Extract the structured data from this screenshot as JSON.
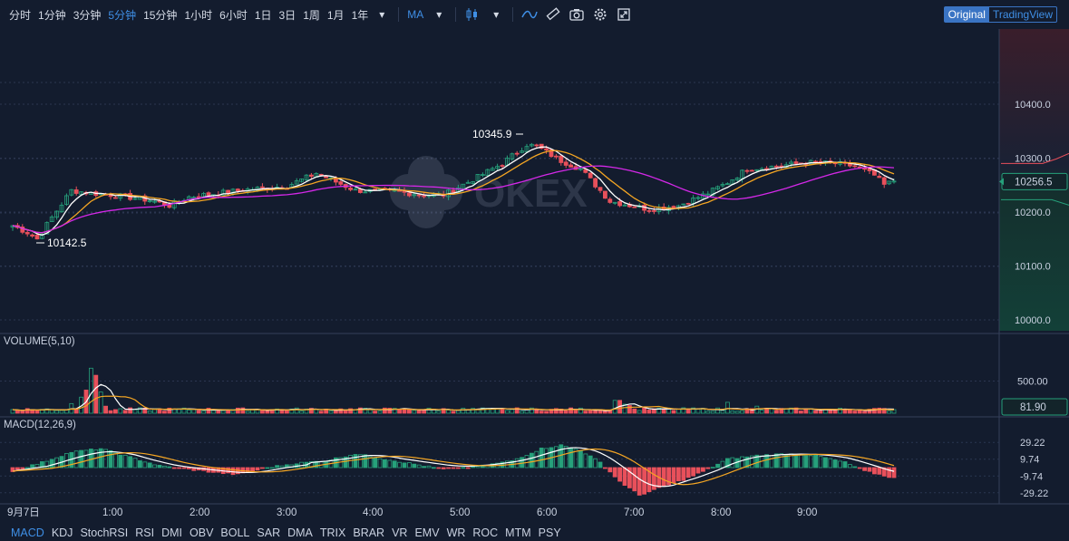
{
  "toolbar": {
    "intervals": [
      "分时",
      "1分钟",
      "3分钟",
      "5分钟",
      "15分钟",
      "1小时",
      "6小时",
      "1日",
      "3日",
      "1周",
      "1月",
      "1年"
    ],
    "active_interval": "5分钟",
    "indicator_label": "MA"
  },
  "view_toggle": {
    "original": "Original",
    "tradingview": "TradingView"
  },
  "watermark": "OKEX",
  "colors": {
    "up": "#26a17b",
    "down": "#e8505b",
    "ma5": "#ffffff",
    "ma10": "#f5a623",
    "ma30": "#d428e8",
    "grid": "#2b3650",
    "background": "#131c2e"
  },
  "chart_data": {
    "type": "candlestick",
    "price_axis": {
      "ticks": [
        10000,
        10100,
        10200,
        10300,
        10400
      ],
      "tick_labels": [
        "10000.0",
        "10100.0",
        "10200.0",
        "10300.0",
        "10400.0"
      ],
      "current_price": "10256.5"
    },
    "annotations": {
      "high_label": "10345.9",
      "low_label": "10142.5"
    },
    "time_axis": {
      "labels": [
        "9月7日",
        "1:00",
        "2:00",
        "3:00",
        "4:00",
        "5:00",
        "6:00",
        "7:00",
        "8:00",
        "9:00"
      ]
    },
    "price_anchors": [
      [
        0,
        10175
      ],
      [
        3,
        10162
      ],
      [
        5,
        10150
      ],
      [
        8,
        10190
      ],
      [
        12,
        10240
      ],
      [
        16,
        10235
      ],
      [
        20,
        10232
      ],
      [
        28,
        10222
      ],
      [
        32,
        10212
      ],
      [
        36,
        10228
      ],
      [
        48,
        10242
      ],
      [
        56,
        10248
      ],
      [
        62,
        10272
      ],
      [
        70,
        10240
      ],
      [
        78,
        10238
      ],
      [
        84,
        10232
      ],
      [
        88,
        10232
      ],
      [
        95,
        10265
      ],
      [
        100,
        10290
      ],
      [
        105,
        10325
      ],
      [
        107,
        10322
      ],
      [
        112,
        10295
      ],
      [
        116,
        10280
      ],
      [
        118,
        10260
      ],
      [
        122,
        10220
      ],
      [
        130,
        10205
      ],
      [
        136,
        10212
      ],
      [
        142,
        10235
      ],
      [
        146,
        10255
      ],
      [
        150,
        10280
      ],
      [
        156,
        10285
      ],
      [
        162,
        10292
      ],
      [
        168,
        10290
      ],
      [
        172,
        10285
      ],
      [
        176,
        10268
      ],
      [
        178,
        10250
      ],
      [
        180,
        10258
      ]
    ],
    "volume": {
      "label": "VOLUME(5,10)",
      "tick_labels": [
        "500.00"
      ],
      "current": "81.90",
      "spikes": [
        [
          12,
          150
        ],
        [
          14,
          250
        ],
        [
          15,
          360
        ],
        [
          16,
          700
        ],
        [
          17,
          590
        ],
        [
          18,
          330
        ],
        [
          19,
          110
        ],
        [
          123,
          200
        ],
        [
          124,
          200
        ],
        [
          125,
          140
        ],
        [
          126,
          120
        ],
        [
          146,
          170
        ],
        [
          152,
          110
        ]
      ]
    },
    "macd": {
      "label": "MACD(12,26,9)",
      "tick_labels": [
        "29.22",
        "9.74",
        "-9.74",
        "-29.22"
      ],
      "anchors": [
        [
          0,
          -4
        ],
        [
          6,
          6
        ],
        [
          12,
          18
        ],
        [
          18,
          22
        ],
        [
          24,
          12
        ],
        [
          30,
          2
        ],
        [
          36,
          -2
        ],
        [
          42,
          -6
        ],
        [
          46,
          -8
        ],
        [
          52,
          0
        ],
        [
          58,
          5
        ],
        [
          64,
          8
        ],
        [
          70,
          16
        ],
        [
          76,
          10
        ],
        [
          82,
          4
        ],
        [
          88,
          -2
        ],
        [
          96,
          2
        ],
        [
          102,
          8
        ],
        [
          108,
          22
        ],
        [
          112,
          26
        ],
        [
          116,
          20
        ],
        [
          120,
          6
        ],
        [
          124,
          -16
        ],
        [
          128,
          -32
        ],
        [
          132,
          -24
        ],
        [
          138,
          -12
        ],
        [
          142,
          -2
        ],
        [
          146,
          10
        ],
        [
          152,
          14
        ],
        [
          158,
          16
        ],
        [
          164,
          14
        ],
        [
          170,
          6
        ],
        [
          174,
          -4
        ],
        [
          180,
          -12
        ]
      ]
    },
    "indicators": [
      "MACD",
      "KDJ",
      "StochRSI",
      "RSI",
      "DMI",
      "OBV",
      "BOLL",
      "SAR",
      "DMA",
      "TRIX",
      "BRAR",
      "VR",
      "EMV",
      "WR",
      "ROC",
      "MTM",
      "PSY"
    ],
    "active_indicator": "MACD"
  }
}
